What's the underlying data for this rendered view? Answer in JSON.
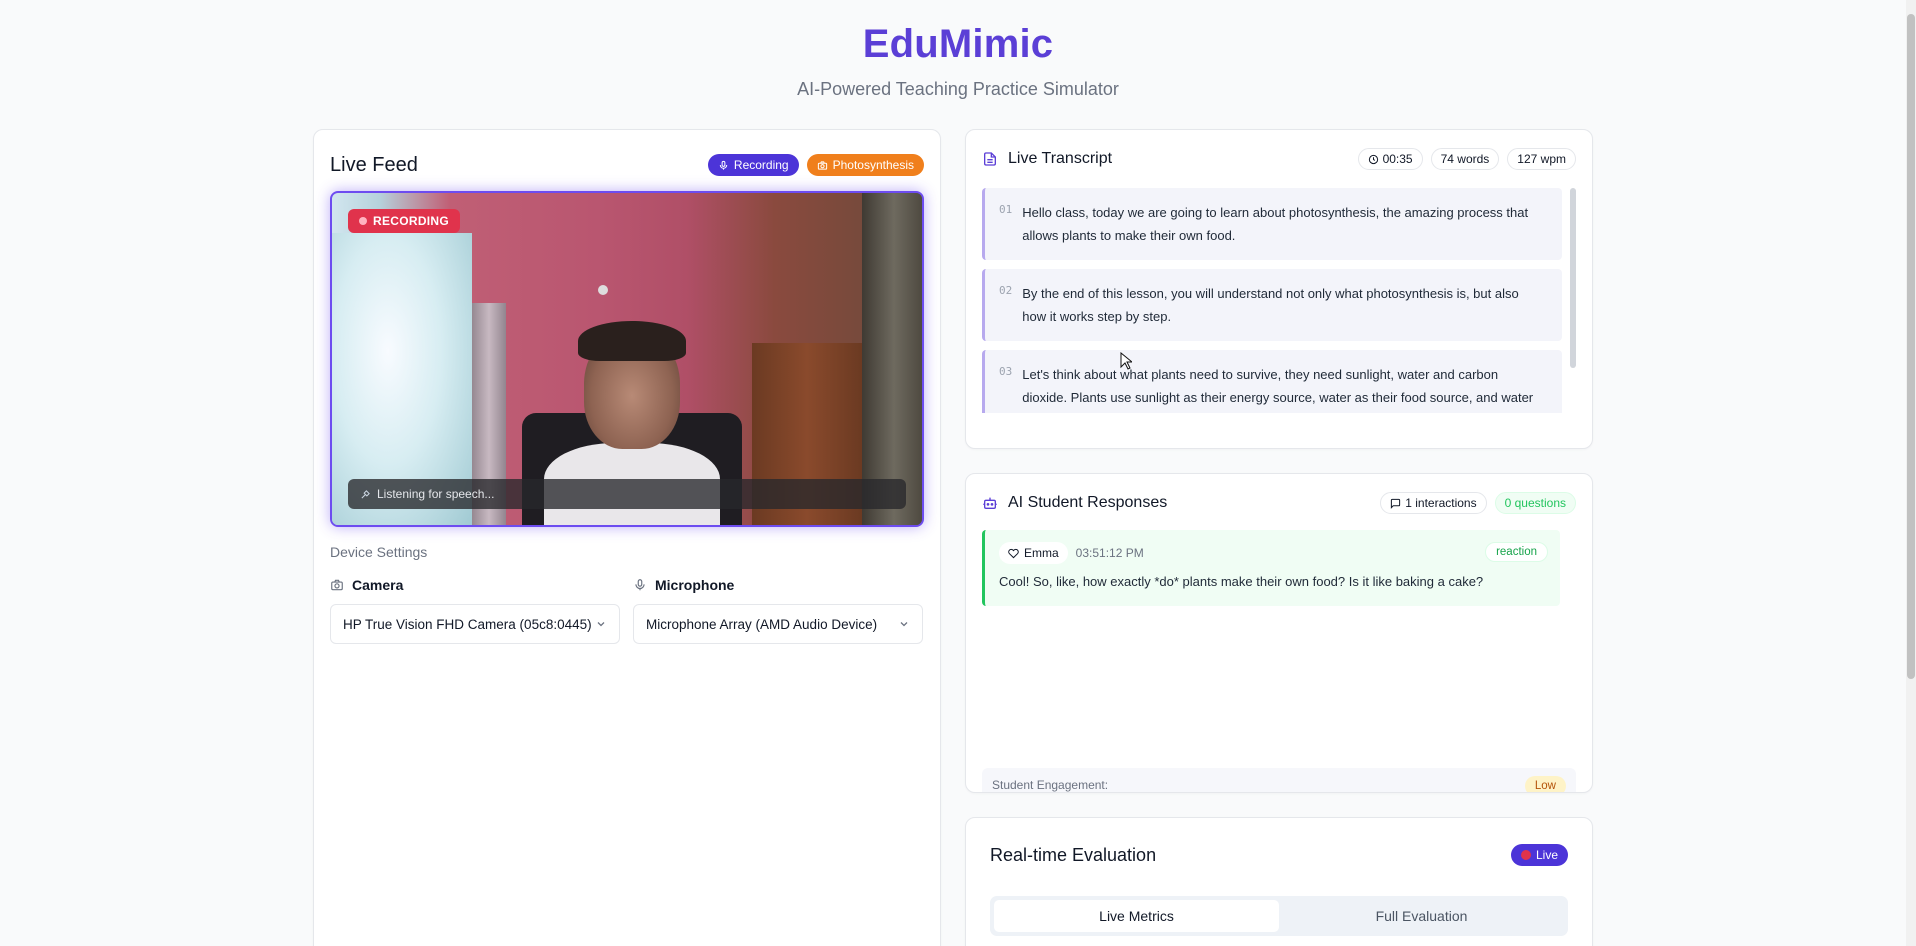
{
  "header": {
    "title": "EduMimic",
    "subtitle": "AI-Powered Teaching Practice Simulator"
  },
  "live_feed": {
    "title": "Live Feed",
    "chip_recording": "Recording",
    "chip_topic": "Photosynthesis",
    "rec_badge": "RECORDING",
    "listening": "Listening for speech...",
    "device_settings": "Device Settings",
    "camera_label": "Camera",
    "camera_value": "HP True Vision FHD Camera (05c8:0445)",
    "microphone_label": "Microphone",
    "microphone_value": "Microphone Array (AMD Audio Device)"
  },
  "transcript": {
    "title": "Live Transcript",
    "time": "00:35",
    "words": "74 words",
    "wpm": "127 wpm",
    "items": [
      {
        "num": "01",
        "text": "Hello class, today we are going to learn about photosynthesis, the amazing process that allows plants to make their own food."
      },
      {
        "num": "02",
        "text": "By the end of this lesson, you will understand not only what photosynthesis is, but also how it works step by step."
      },
      {
        "num": "03",
        "text": "Let's think about what plants need to survive, they need sunlight, water and carbon dioxide. Plants use sunlight as their energy source, water as their food source, and water as their"
      }
    ]
  },
  "students": {
    "title": "AI Student Responses",
    "interactions": "1 interactions",
    "questions": "0 questions",
    "response": {
      "name": "Emma",
      "time": "03:51:12 PM",
      "tag": "reaction",
      "text": "Cool! So, like, how exactly *do* plants make their own food? Is it like baking a cake?"
    },
    "engagement_label": "Student Engagement:",
    "engagement_value": "Low"
  },
  "evaluation": {
    "title": "Real-time Evaluation",
    "live": "Live",
    "tab_live": "Live Metrics",
    "tab_full": "Full Evaluation"
  },
  "colors": {
    "brand": "#5b3fd6",
    "recording": "#e0334c",
    "topic": "#f07f1c",
    "student": "#22c55e"
  }
}
